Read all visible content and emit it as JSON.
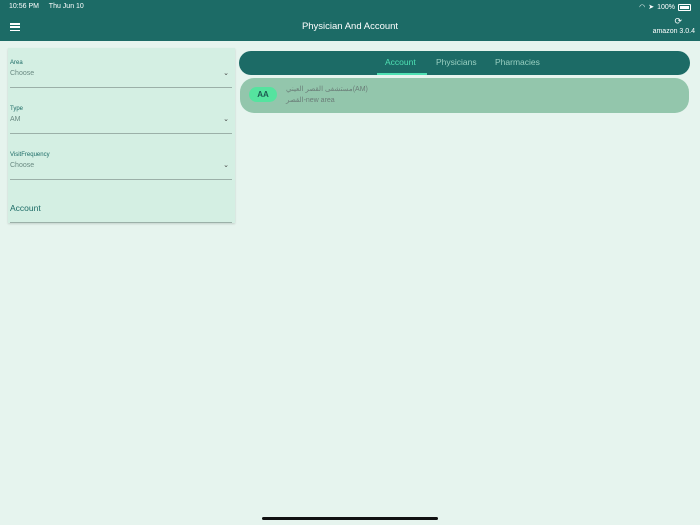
{
  "status_bar": {
    "time": "10:56 PM",
    "date": "Thu Jun 10",
    "battery": "100%"
  },
  "header": {
    "title": "Physician And Account",
    "version": "amazon 3.0.4",
    "menu_icon": "hamburger-menu-icon",
    "sync_icon": "sync-icon"
  },
  "filters": {
    "area": {
      "label": "Area",
      "value": "Choose"
    },
    "type": {
      "label": "Type",
      "value": "AM"
    },
    "visit_frequency": {
      "label": "VisitFrequency",
      "value": "Choose"
    },
    "account": {
      "label": "Account"
    }
  },
  "tabs": [
    {
      "label": "Account",
      "active": true
    },
    {
      "label": "Physicians",
      "active": false
    },
    {
      "label": "Pharmacies",
      "active": false
    }
  ],
  "results": [
    {
      "initials": "AA",
      "line1": "مستشفى القصر العيني(AM)",
      "line2": "القصر-new area"
    }
  ],
  "colors": {
    "primary": "#1c6b66",
    "accent": "#4fe0b3",
    "panel": "#d4efe3",
    "card": "#93c6ac",
    "background": "#e6f4ee"
  }
}
